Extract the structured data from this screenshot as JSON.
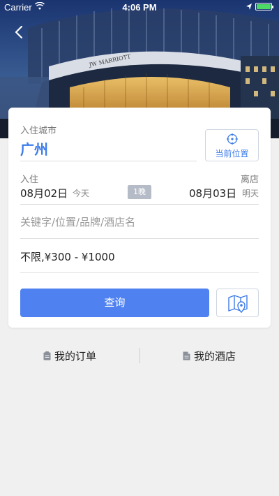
{
  "status_bar": {
    "carrier": "Carrier",
    "time": "4:06 PM"
  },
  "hero": {
    "sign_text": "JW MARRIOTT"
  },
  "search": {
    "city_label": "入住城市",
    "city_value": "广州",
    "location_button_label": "当前位置",
    "checkin_label": "入住",
    "checkout_label": "离店",
    "checkin_date": "08月02日",
    "checkin_sub": "今天",
    "nights": "1晚",
    "checkout_date": "08月03日",
    "checkout_sub": "明天",
    "keyword_placeholder": "关键字/位置/品牌/酒店名",
    "keyword_value": "",
    "price_value": "不限,¥300 - ¥1000",
    "search_button_label": "查询"
  },
  "links": {
    "my_orders": "我的订单",
    "my_hotels": "我的酒店"
  },
  "colors": {
    "accent": "#4f82f0",
    "city_text": "#3d7be8",
    "battery": "#4cd964"
  }
}
